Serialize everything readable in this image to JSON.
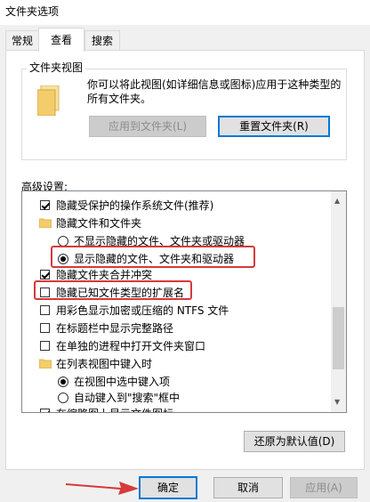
{
  "window": {
    "title": "文件夹选项"
  },
  "tabs": [
    {
      "label": "常规"
    },
    {
      "label": "查看"
    },
    {
      "label": "搜索"
    }
  ],
  "folder_views": {
    "label": "文件夹视图",
    "description": "你可以将此视图(如详细信息或图标)应用于这种类型的所有文件夹。",
    "apply_button": "应用到文件夹(L)",
    "reset_button": "重置文件夹(R)"
  },
  "advanced": {
    "label": "高级设置:",
    "items": [
      {
        "text": "隐藏受保护的操作系统文件(推荐)"
      },
      {
        "text": "隐藏文件和文件夹"
      },
      {
        "text": "不显示隐藏的文件、文件夹或驱动器"
      },
      {
        "text": "显示隐藏的文件、文件夹和驱动器"
      },
      {
        "text": "隐藏文件夹合并冲突"
      },
      {
        "text": "隐藏已知文件类型的扩展名"
      },
      {
        "text": "用彩色显示加密或压缩的 NTFS 文件"
      },
      {
        "text": "在标题栏中显示完整路径"
      },
      {
        "text": "在单独的进程中打开文件夹窗口"
      },
      {
        "text": "在列表视图中键入时"
      },
      {
        "text": "在视图中选中键入项"
      },
      {
        "text": "自动键入到\"搜索\"框中"
      },
      {
        "text": "在缩略图上显示文件图标"
      }
    ]
  },
  "restore_button": "还原为默认值(D)",
  "footer": {
    "ok": "确定",
    "cancel": "取消",
    "apply": "应用(A)"
  },
  "colors": {
    "highlight": "#d63a3a",
    "focus": "#0078d7",
    "folder": "#f3cd6b"
  }
}
